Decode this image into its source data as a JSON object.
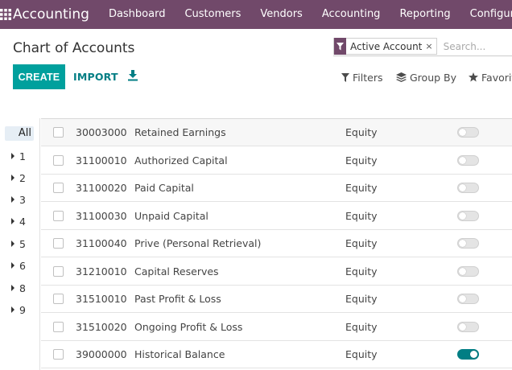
{
  "navbar": {
    "app_name": "Accounting",
    "menu": [
      "Dashboard",
      "Customers",
      "Vendors",
      "Accounting",
      "Reporting",
      "Configuration"
    ],
    "apps_icon": "grid-icon",
    "bg_color": "#71496a"
  },
  "control_panel": {
    "title": "Chart of Accounts",
    "create_label": "CREATE",
    "import_label": "IMPORT",
    "download_icon": "download-icon",
    "accent_color": "#00a09d"
  },
  "search": {
    "facet_label": "Active Account",
    "facet_close": "×",
    "placeholder": "Search..."
  },
  "tools": {
    "filters_label": "Filters",
    "group_by_label": "Group By",
    "favorites_label": "Favorites"
  },
  "side_panel": {
    "all_label": "All",
    "items": [
      "1",
      "2",
      "3",
      "4",
      "5",
      "6",
      "8",
      "9"
    ]
  },
  "accounts": [
    {
      "code": "30003000",
      "name": "Retained Earnings",
      "type": "Equity",
      "toggle": false
    },
    {
      "code": "31100010",
      "name": "Authorized Capital",
      "type": "Equity",
      "toggle": false
    },
    {
      "code": "31100020",
      "name": "Paid Capital",
      "type": "Equity",
      "toggle": false
    },
    {
      "code": "31100030",
      "name": "Unpaid Capital",
      "type": "Equity",
      "toggle": false
    },
    {
      "code": "31100040",
      "name": "Prive (Personal Retrieval)",
      "type": "Equity",
      "toggle": false
    },
    {
      "code": "31210010",
      "name": "Capital Reserves",
      "type": "Equity",
      "toggle": false
    },
    {
      "code": "31510010",
      "name": "Past Profit & Loss",
      "type": "Equity",
      "toggle": false
    },
    {
      "code": "31510020",
      "name": "Ongoing Profit & Loss",
      "type": "Equity",
      "toggle": false
    },
    {
      "code": "39000000",
      "name": "Historical Balance",
      "type": "Equity",
      "toggle": true
    }
  ]
}
